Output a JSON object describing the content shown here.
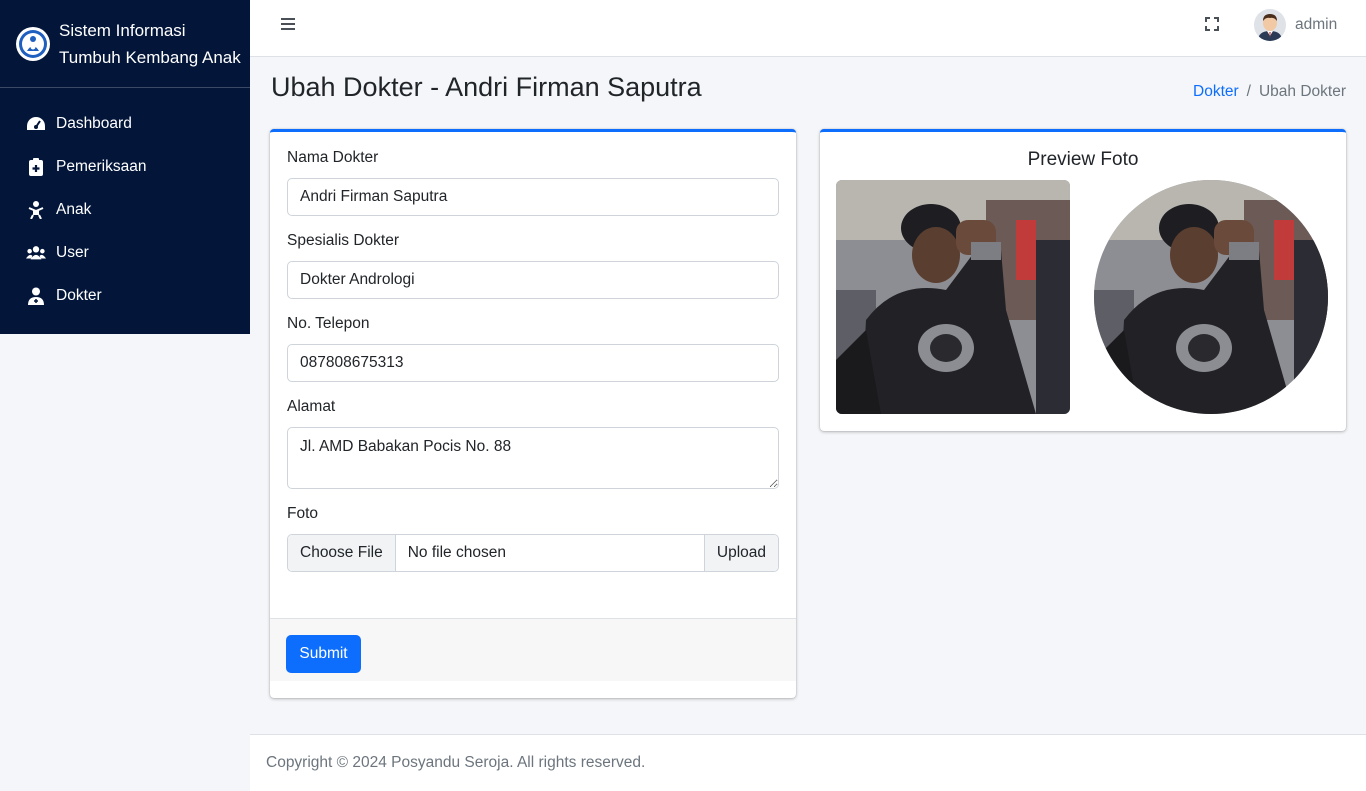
{
  "app": {
    "title_line1": "Sistem Informasi",
    "title_line2": "Tumbuh Kembang Anak"
  },
  "sidebar": {
    "items": [
      {
        "label": "Dashboard",
        "icon": "dashboard-icon"
      },
      {
        "label": "Pemeriksaan",
        "icon": "clipboard-icon"
      },
      {
        "label": "Anak",
        "icon": "child-icon"
      },
      {
        "label": "User",
        "icon": "users-icon"
      },
      {
        "label": "Dokter",
        "icon": "doctor-icon"
      }
    ]
  },
  "topbar": {
    "user_name": "admin"
  },
  "page": {
    "title": "Ubah Dokter - Andri Firman Saputra",
    "breadcrumb": {
      "link": "Dokter",
      "separator": "/",
      "active": "Ubah Dokter"
    }
  },
  "form": {
    "nama_label": "Nama Dokter",
    "nama_value": "Andri Firman Saputra",
    "spesialis_label": "Spesialis Dokter",
    "spesialis_value": "Dokter Andrologi",
    "telepon_label": "No. Telepon",
    "telepon_value": "087808675313",
    "alamat_label": "Alamat",
    "alamat_value": "Jl. AMD Babakan Pocis No. 88",
    "foto_label": "Foto",
    "file_choose": "Choose File",
    "file_name": "No file chosen",
    "upload_label": "Upload",
    "submit_label": "Submit"
  },
  "preview": {
    "title": "Preview Foto"
  },
  "footer": {
    "copyright": "Copyright © 2024 Posyandu Seroja. All rights reserved."
  },
  "colors": {
    "sidebar_bg": "#03163a",
    "primary": "#0d6efd",
    "page_bg": "#f4f6f9"
  }
}
